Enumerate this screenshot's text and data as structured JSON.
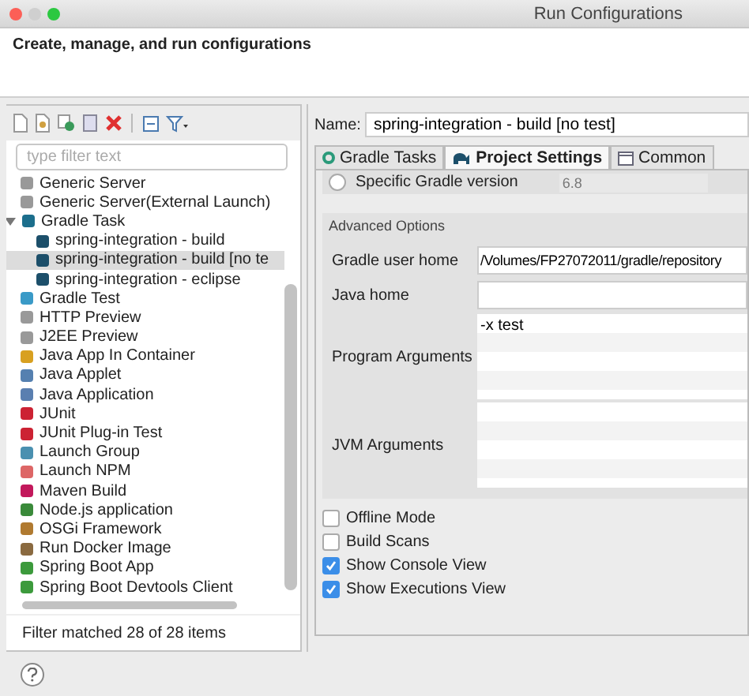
{
  "window": {
    "title": "Run Configurations"
  },
  "header": {
    "message": "Create, manage, and run configurations"
  },
  "left": {
    "filter": {
      "placeholder": "type filter text"
    },
    "tree": [
      {
        "label": "Generic Server",
        "selected": false
      },
      {
        "label": "Generic Server(External Launch)",
        "selected": false
      },
      {
        "label": "Gradle Task",
        "selected": false,
        "expanded": true,
        "children": [
          {
            "label": "spring-integration - build",
            "selected": false
          },
          {
            "label": "spring-integration - build [no te",
            "selected": true
          },
          {
            "label": "spring-integration - eclipse",
            "selected": false
          }
        ]
      },
      {
        "label": "Gradle Test",
        "selected": false
      },
      {
        "label": "HTTP Preview",
        "selected": false
      },
      {
        "label": "J2EE Preview",
        "selected": false
      },
      {
        "label": "Java App In Container",
        "selected": false
      },
      {
        "label": "Java Applet",
        "selected": false
      },
      {
        "label": "Java Application",
        "selected": false
      },
      {
        "label": "JUnit",
        "selected": false
      },
      {
        "label": "JUnit Plug-in Test",
        "selected": false
      },
      {
        "label": "Launch Group",
        "selected": false
      },
      {
        "label": "Launch NPM",
        "selected": false
      },
      {
        "label": "Maven Build",
        "selected": false
      },
      {
        "label": "Node.js application",
        "selected": false
      },
      {
        "label": "OSGi Framework",
        "selected": false
      },
      {
        "label": "Run Docker Image",
        "selected": false
      },
      {
        "label": "Spring Boot App",
        "selected": false
      },
      {
        "label": "Spring Boot Devtools Client",
        "selected": false
      }
    ],
    "status": "Filter matched 28 of 28 items"
  },
  "name_field": {
    "label": "Name:",
    "value": "spring-integration - build [no test]"
  },
  "tabs": [
    {
      "label": "Gradle Tasks",
      "selected": false
    },
    {
      "label": "Project Settings",
      "selected": true
    },
    {
      "label": "Common",
      "selected": false
    }
  ],
  "gradle_version": {
    "label": "Specific Gradle version",
    "selected": false,
    "value": "6.8"
  },
  "advanced": {
    "title": "Advanced Options",
    "fields": [
      {
        "label": "Gradle user home",
        "kind": "line",
        "value": "/Volumes/FP27072011/gradle/repository"
      },
      {
        "label": "Java home",
        "kind": "line"
      },
      {
        "label": "Program Arguments",
        "kind": "area",
        "value": "-x test"
      },
      {
        "label": "JVM Arguments",
        "kind": "area"
      }
    ]
  },
  "checkboxes": [
    {
      "label": "Offline Mode",
      "checked": false
    },
    {
      "label": "Build Scans",
      "checked": false
    },
    {
      "label": "Show Console View",
      "checked": true
    },
    {
      "label": "Show Executions View",
      "checked": true
    }
  ]
}
